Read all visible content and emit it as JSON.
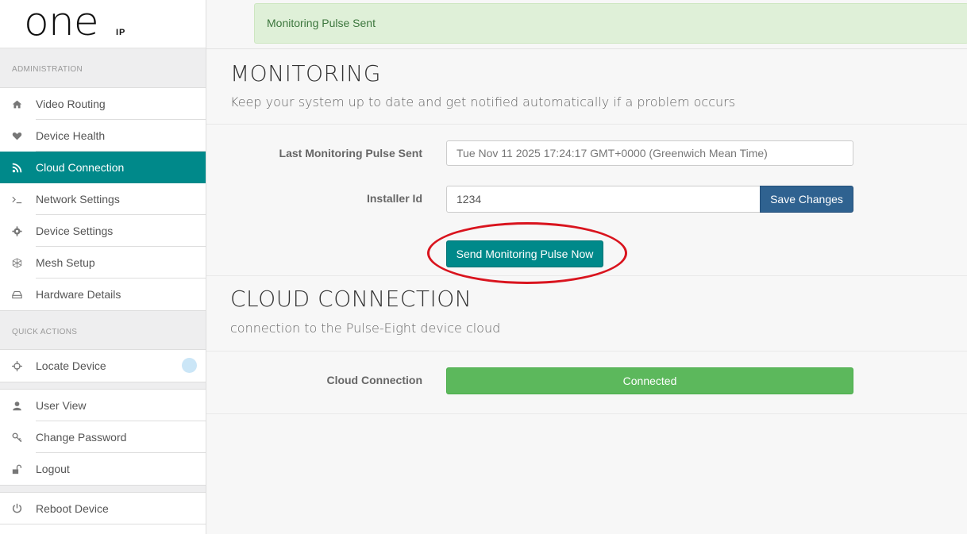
{
  "brand": {
    "logo_text": "one",
    "logo_sub": "IP"
  },
  "sidebar": {
    "section_admin": "ADMINISTRATION",
    "admin_items": [
      {
        "label": "Video Routing",
        "icon": "home-icon"
      },
      {
        "label": "Device Health",
        "icon": "heart-icon"
      },
      {
        "label": "Cloud Connection",
        "icon": "rss-icon",
        "active": true
      },
      {
        "label": "Network Settings",
        "icon": "terminal-icon"
      },
      {
        "label": "Device Settings",
        "icon": "gear-icon"
      },
      {
        "label": "Mesh Setup",
        "icon": "mesh-icon"
      },
      {
        "label": "Hardware Details",
        "icon": "hdd-icon"
      }
    ],
    "section_quick": "QUICK ACTIONS",
    "quick_items": [
      {
        "label": "Locate Device",
        "icon": "crosshair-icon"
      }
    ],
    "user_items": [
      {
        "label": "User View",
        "icon": "user-icon"
      },
      {
        "label": "Change Password",
        "icon": "key-icon"
      },
      {
        "label": "Logout",
        "icon": "unlock-icon"
      }
    ],
    "system_items": [
      {
        "label": "Reboot Device",
        "icon": "power-icon"
      }
    ]
  },
  "alert": {
    "text": "Monitoring Pulse Sent"
  },
  "monitoring": {
    "title": "MONITORING",
    "subtitle": "Keep your system up to date and get notified automatically if a problem occurs",
    "last_pulse_label": "Last Monitoring Pulse Sent",
    "last_pulse_value": "Tue Nov 11 2025 17:24:17 GMT+0000 (Greenwich Mean Time)",
    "installer_label": "Installer Id",
    "installer_value": "1234",
    "save_button": "Save Changes",
    "pulse_button": "Send Monitoring Pulse Now"
  },
  "cloud": {
    "title": "CLOUD CONNECTION",
    "subtitle": "connection to the Pulse-Eight device cloud",
    "status_label": "Cloud Connection",
    "status_value": "Connected"
  },
  "colors": {
    "accent": "#00898a",
    "primary_button": "#2f6290",
    "success": "#5cb85c",
    "alert_bg": "#dff0d8",
    "annotation": "#d9141e"
  }
}
